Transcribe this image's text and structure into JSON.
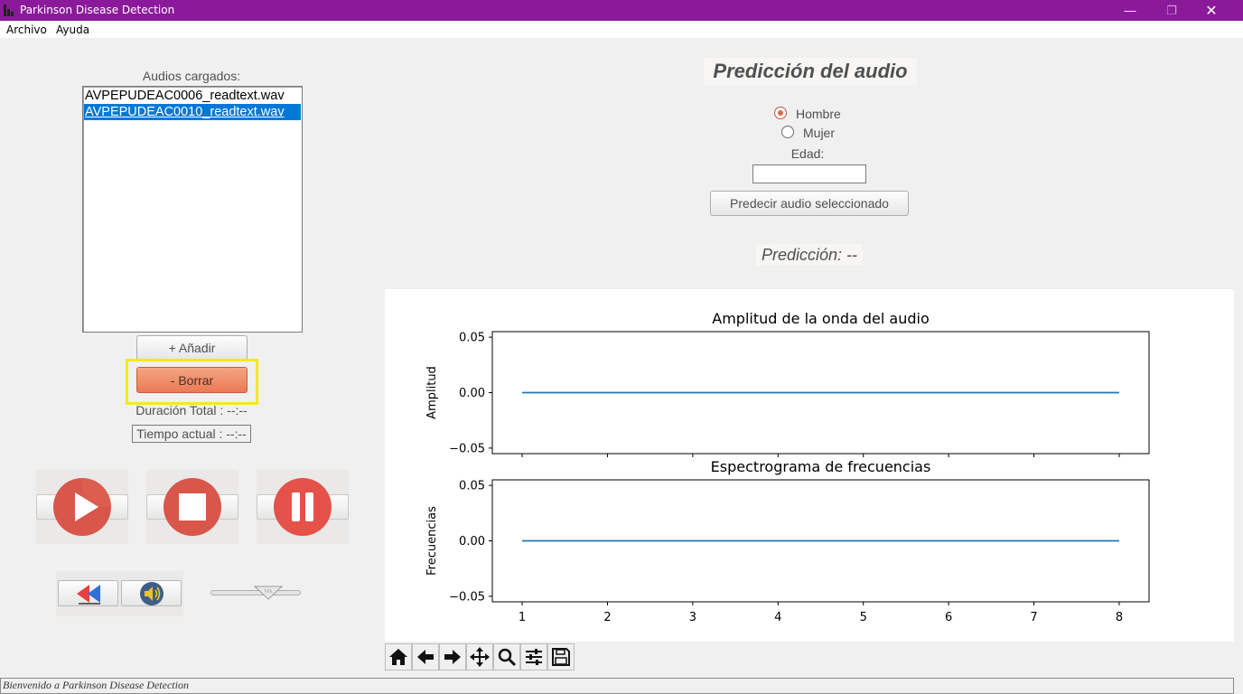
{
  "window": {
    "title": "Parkinson Disease Detection",
    "minimize": "—",
    "maximize": "❐",
    "close": "✕"
  },
  "menu": {
    "items": [
      "Archivo",
      "Ayuda"
    ]
  },
  "audio_list": {
    "title": "Audios cargados:",
    "items": [
      "AVPEPUDEAC0006_readtext.wav",
      "AVPEPUDEAC0010_readtext.wav"
    ],
    "selected_index": 1
  },
  "buttons": {
    "add": "+ Añadir",
    "delete": "- Borrar",
    "predict": "Predecir audio seleccionado"
  },
  "playback": {
    "duration_label": "Duración Total : --:--",
    "current_time_label": "Tiempo actual : --:--",
    "controls": [
      "play-icon",
      "stop-icon",
      "pause-icon"
    ],
    "extra_controls": [
      "rewind-icon",
      "speaker-icon"
    ],
    "volume_level": 0.64
  },
  "prediction": {
    "title": "Predicción del audio",
    "gender_options": [
      "Hombre",
      "Mujer"
    ],
    "selected_gender": "Hombre",
    "age_label": "Edad:",
    "age_value": "",
    "result_label": "Predicción: --"
  },
  "colors": {
    "titlebar": "#8b1a9b",
    "selection": "#0078d7",
    "delete_button": "#ea7a55",
    "media_button": "#d9564a",
    "line": "#1f77b4",
    "highlight": "#f3ea1a"
  },
  "chart_data": [
    {
      "type": "line",
      "title": "Amplitud de la onda del audio",
      "xlabel": "",
      "ylabel": "Amplitud",
      "x": [
        1,
        2,
        3,
        4,
        5,
        6,
        7,
        8
      ],
      "series": [
        {
          "values": [
            0,
            0,
            0,
            0,
            0,
            0,
            0,
            0
          ]
        }
      ],
      "xlim": [
        0.65,
        8.35
      ],
      "ylim": [
        -0.055,
        0.055
      ],
      "yticks": [
        "0.05",
        "0.00",
        "−0.05"
      ],
      "xticks": [],
      "grid": false
    },
    {
      "type": "line",
      "title": "Espectrograma de frecuencias",
      "xlabel": "",
      "ylabel": "Frecuencias",
      "x": [
        1,
        2,
        3,
        4,
        5,
        6,
        7,
        8
      ],
      "series": [
        {
          "values": [
            0,
            0,
            0,
            0,
            0,
            0,
            0,
            0
          ]
        }
      ],
      "xlim": [
        0.65,
        8.35
      ],
      "ylim": [
        -0.055,
        0.055
      ],
      "yticks": [
        "0.05",
        "0.00",
        "−0.05"
      ],
      "xticks": [
        "1",
        "2",
        "3",
        "4",
        "5",
        "6",
        "7",
        "8"
      ],
      "grid": false
    }
  ],
  "toolbar": {
    "tools": [
      "home-icon",
      "back-icon",
      "forward-icon",
      "pan-icon",
      "zoom-icon",
      "configure-icon",
      "save-icon"
    ]
  },
  "status": {
    "message": "Bienvenido a Parkinson Disease Detection"
  }
}
